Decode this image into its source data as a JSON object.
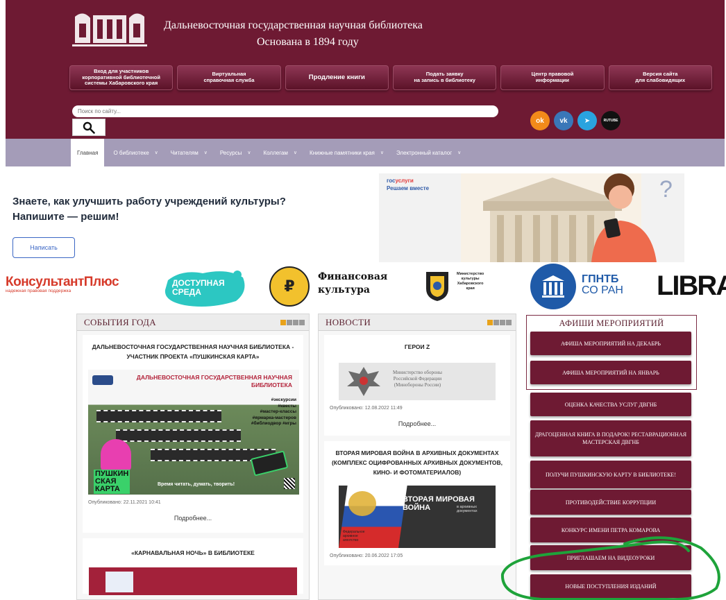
{
  "header": {
    "title": "Дальневосточная государственная научная библиотека",
    "subtitle": "Основана в 1894 году",
    "buttons": [
      "Вход для участников\nкорпоративной библиотечной\nсистемы Хабаровского края",
      "Виртуальная\nсправочная служба",
      "Продление книги",
      "Подать заявку\nна запись в библиотеку",
      "Центр правовой\nинформации",
      "Версия сайта\nдля слабовидящих"
    ],
    "search_placeholder": "Поиск по сайту...",
    "search_icon": "magnifier-icon",
    "socials": [
      {
        "name": "ok",
        "glyph": "ok"
      },
      {
        "name": "vk",
        "glyph": "vk"
      },
      {
        "name": "telegram",
        "glyph": "➤"
      },
      {
        "name": "rutube",
        "glyph": "RUTUBE"
      }
    ]
  },
  "nav": [
    {
      "label": "Главная",
      "active": true
    },
    {
      "label": "О библиотеке"
    },
    {
      "label": "Читателям"
    },
    {
      "label": "Ресурсы"
    },
    {
      "label": "Коллегам"
    },
    {
      "label": "Книжные памятники края"
    },
    {
      "label": "Электронный каталог"
    }
  ],
  "banner": {
    "question_line1": "Знаете, как улучшить работу учреждений культуры?",
    "question_line2": "Напишите — решим!",
    "write_button": "Написать",
    "gos_line1a": "гос",
    "gos_line1b": "услуги",
    "gos_line2": "Решаем вместе"
  },
  "partners": {
    "konsultant": "КонсультантПлюс",
    "konsultant_sub": "надежная правовая поддержка",
    "dostupnaya_1": "ДОСТУПНАЯ",
    "dostupnaya_2": "СРЕДА",
    "fin_symbol": "₽",
    "fin_1": "Финансовая",
    "fin_2": "культура",
    "minkult": "Министерство\nкультуры\nХабаровского\nкрая",
    "gpntb_1": "ГПНТБ",
    "gpntb_2": "СО РАН",
    "library": "LIBRAR"
  },
  "events": {
    "header": "СОБЫТИЯ ГОДА",
    "article1": {
      "title": "ДАЛЬНЕВОСТОЧНАЯ ГОСУДАРСТВЕННАЯ НАУЧНАЯ БИБЛИОТЕКА - УЧАСТНИК ПРОЕКТА «ПУШКИНСКАЯ КАРТА»",
      "img_title": "ДАЛЬНЕВОСТОЧНАЯ ГОСУДАРСТВЕННАЯ НАУЧНАЯ БИБЛИОТЕКА",
      "img_list": "#экскурсии\n#квесты\n#мастер-классы\n#ярмарка-мастеров\n#библиодвор #игры",
      "img_brand": "ПУШКИН\nСКАЯ\nКАРТА",
      "img_slogan": "Время читать, думать, творить!",
      "published": "Опубликовано: 22.11.2021 10:41",
      "more": "Подробнее..."
    },
    "article2": {
      "title": "«КАРНАВАЛЬНАЯ НОЧЬ» В БИБЛИОТЕКЕ"
    }
  },
  "news": {
    "header": "НОВОСТИ",
    "article1": {
      "title": "ГЕРОИ Z",
      "img_caption": "Министерство обороны\nРоссийской Федерации\n(Минобороны России)",
      "published": "Опубликовано: 12.08.2022 11:49",
      "more": "Подробнее..."
    },
    "article2": {
      "title": "ВТОРАЯ МИРОВАЯ ВОЙНА В АРХИВНЫХ ДОКУМЕНТАХ (КОМПЛЕКС ОЦИФРОВАННЫХ АРХИВНЫХ ДОКУМЕНТОВ, КИНО- И ФОТОМАТЕРИАЛОВ)",
      "img_title": "ВТОРАЯ МИРОВАЯ\nВОЙНА",
      "img_sub": "в архивных\nдокументах",
      "img_org": "Федеральное\nархивное\nагентство",
      "published": "Опубликовано: 20.06.2022 17:05"
    }
  },
  "afisha": {
    "header": "АФИШИ МЕРОПРИЯТИЙ",
    "buttons": [
      "АФИША МЕРОПРИЯТИЙ НА ДЕКАБРЬ",
      "АФИША МЕРОПРИЯТИЙ НА ЯНВАРЬ"
    ]
  },
  "right_buttons": [
    "ОЦЕНКА КАЧЕСТВА УСЛУГ ДВГНБ",
    "ДРАГОЦЕННАЯ КНИГА В ПОДАРОК! РЕСТАВРАЦИОННАЯ МАСТЕРСКАЯ ДВГНБ",
    "ПОЛУЧИ ПУШКИНСКУЮ КАРТУ В БИБЛИОТЕКЕ!",
    "ПРОТИВОДЕЙСТВИЕ КОРРУПЦИИ",
    "КОНКУРС ИМЕНИ ПЕТРА КОМАРОВА",
    "ПРИГЛАШАЕМ НА ВИДЕОУРОКИ",
    "НОВЫЕ ПОСТУПЛЕНИЯ ИЗДАНИЙ"
  ],
  "colors": {
    "brand": "#6e1a33",
    "nav": "#a49cb8",
    "annotation": "#1ea33a"
  }
}
